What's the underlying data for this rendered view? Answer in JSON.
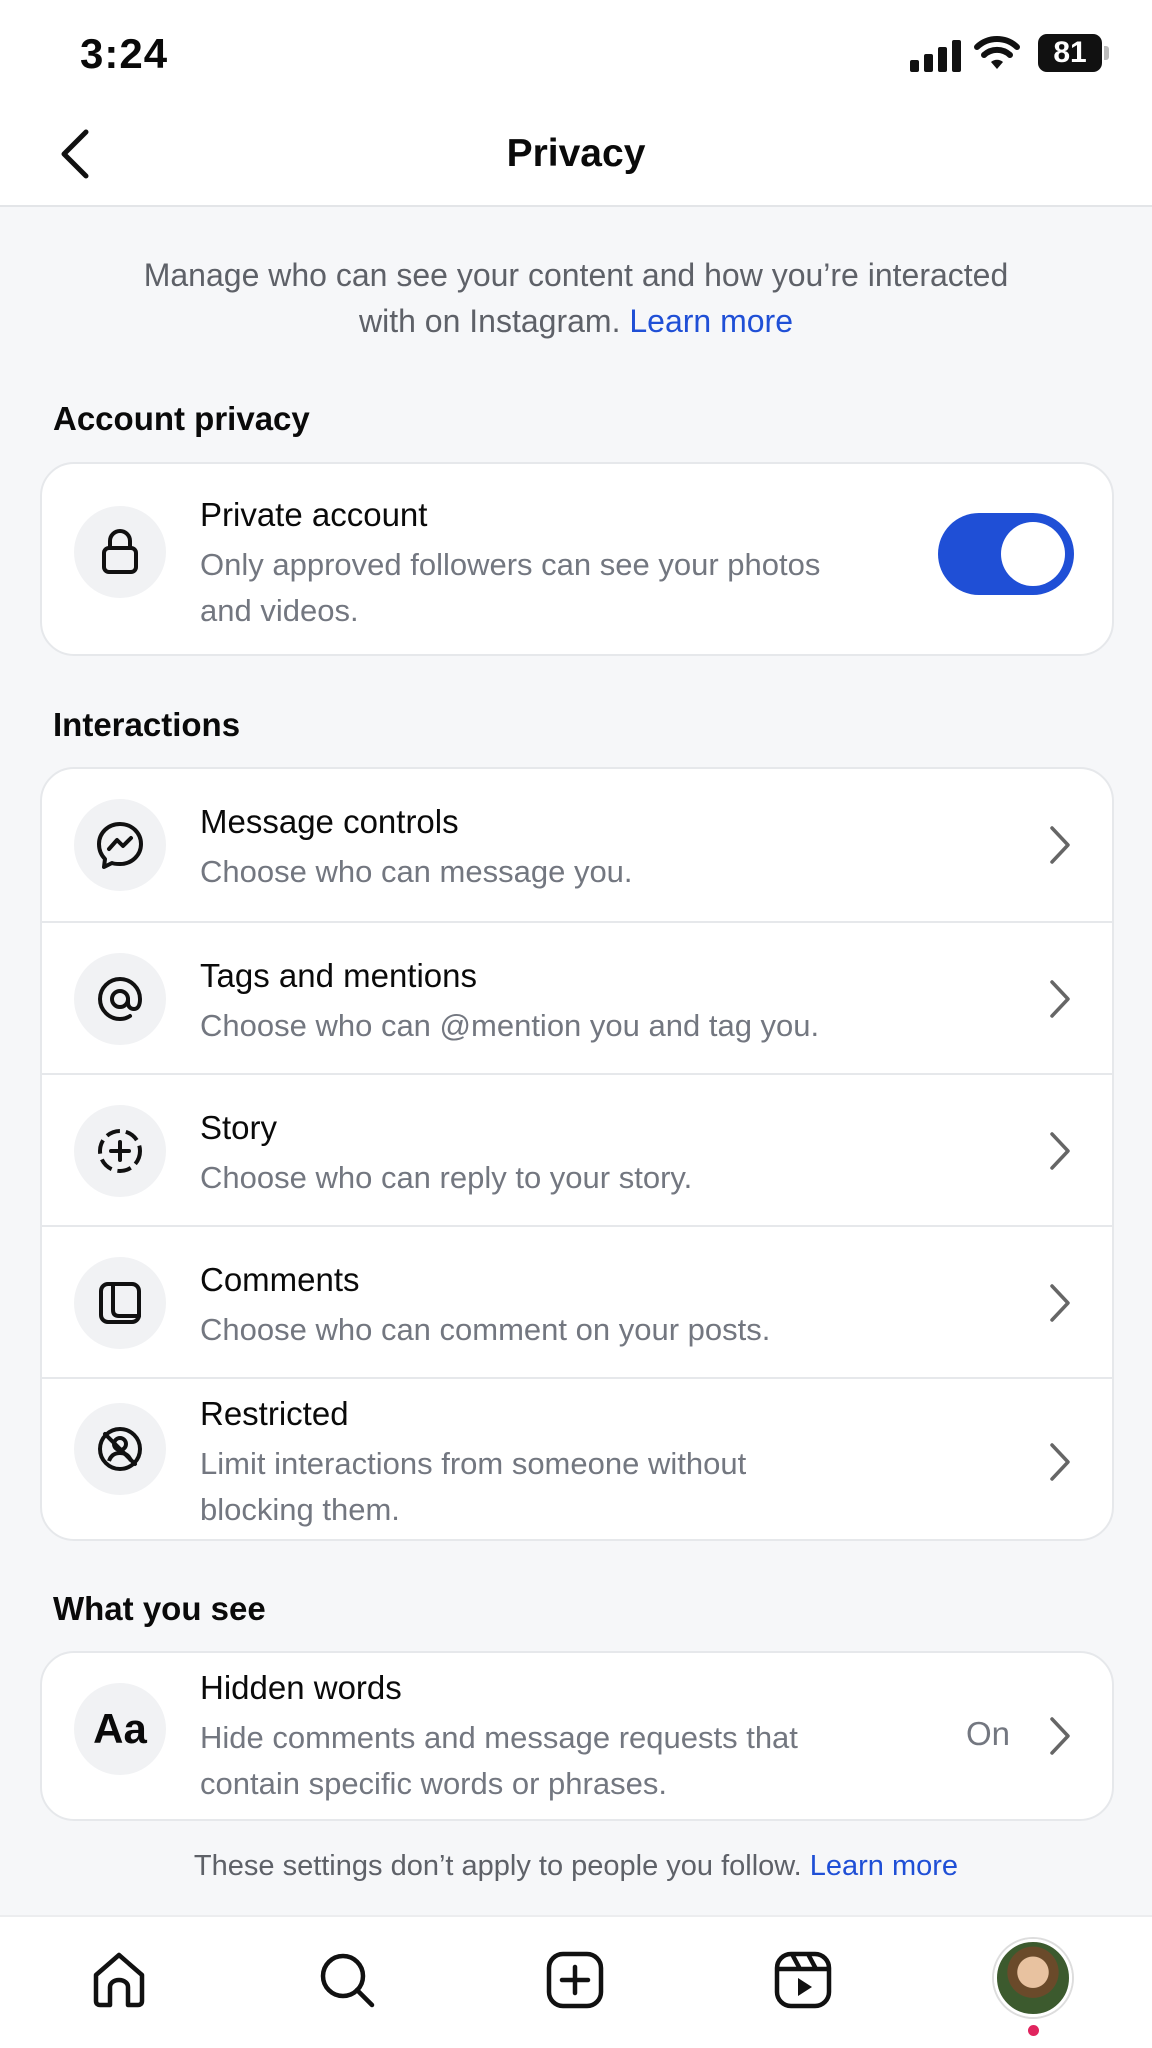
{
  "status_bar": {
    "time": "3:24",
    "battery": "81"
  },
  "header": {
    "title": "Privacy"
  },
  "intro": {
    "text": "Manage who can see your content and how you’re interacted with on Instagram.",
    "link": "Learn more"
  },
  "account_privacy": {
    "section_title": "Account privacy",
    "private_account": {
      "title": "Private account",
      "subtitle": "Only approved followers can see your photos and videos.",
      "enabled": true
    }
  },
  "interactions": {
    "section_title": "Interactions",
    "items": [
      {
        "icon": "messenger-icon",
        "title": "Message controls",
        "subtitle": "Choose who can message you."
      },
      {
        "icon": "at-sign-icon",
        "title": "Tags and mentions",
        "subtitle": "Choose who can @mention you and tag you."
      },
      {
        "icon": "story-add-icon",
        "title": "Story",
        "subtitle": "Choose who can reply to your story."
      },
      {
        "icon": "comment-icon",
        "title": "Comments",
        "subtitle": "Choose who can comment on your posts."
      },
      {
        "icon": "restricted-icon",
        "title": "Restricted",
        "subtitle": "Limit interactions from someone without blocking them."
      }
    ]
  },
  "what_you_see": {
    "section_title": "What you see",
    "hidden_words": {
      "icon_text": "Aa",
      "title": "Hidden words",
      "subtitle": "Hide comments and message requests that contain specific words or phrases.",
      "value": "On"
    }
  },
  "footer": {
    "text": "These settings don’t apply to people you follow.",
    "link": "Learn more"
  },
  "nav": {
    "items": [
      "home-icon",
      "search-icon",
      "create-icon",
      "reels-icon",
      "profile-avatar"
    ]
  },
  "colors": {
    "accent": "#1F4FD6",
    "secondary_text": "#737780"
  }
}
